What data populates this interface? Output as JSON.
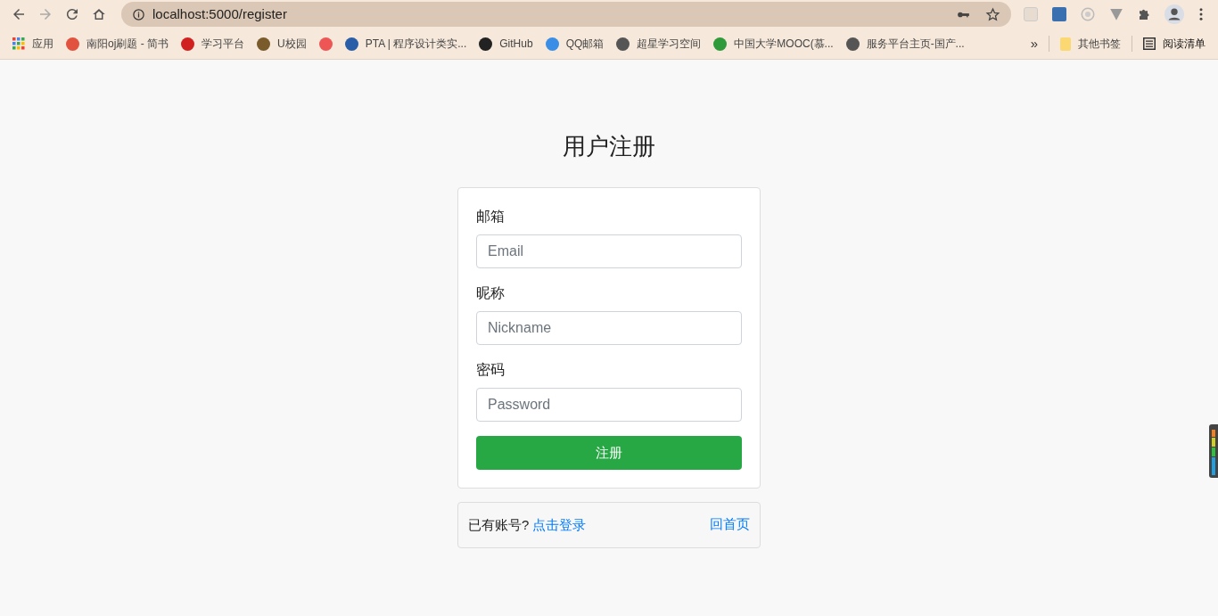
{
  "browser": {
    "address": "localhost:5000/register",
    "bookmarks": [
      {
        "kind": "apps",
        "label": "应用"
      },
      {
        "kind": "link",
        "label": "南阳oj刷题 - 简书"
      },
      {
        "kind": "link",
        "label": "学习平台"
      },
      {
        "kind": "link",
        "label": "U校园"
      },
      {
        "kind": "icon"
      },
      {
        "kind": "link",
        "label": "PTA | 程序设计类实..."
      },
      {
        "kind": "link",
        "label": "GitHub"
      },
      {
        "kind": "link",
        "label": "QQ邮箱"
      },
      {
        "kind": "link",
        "label": "超星学习空间"
      },
      {
        "kind": "link",
        "label": "中国大学MOOC(慕..."
      },
      {
        "kind": "link",
        "label": "服务平台主页-国产..."
      }
    ],
    "overflow": "»",
    "other_bookmarks": "其他书签",
    "reading_list": "阅读清单"
  },
  "page": {
    "title": "用户注册",
    "fields": [
      {
        "label": "邮箱",
        "placeholder": "Email"
      },
      {
        "label": "昵称",
        "placeholder": "Nickname"
      },
      {
        "label": "密码",
        "placeholder": "Password"
      }
    ],
    "submit": "注册",
    "footer": {
      "prompt": "已有账号?",
      "login_link": "点击登录",
      "home_link": "回首页"
    }
  }
}
